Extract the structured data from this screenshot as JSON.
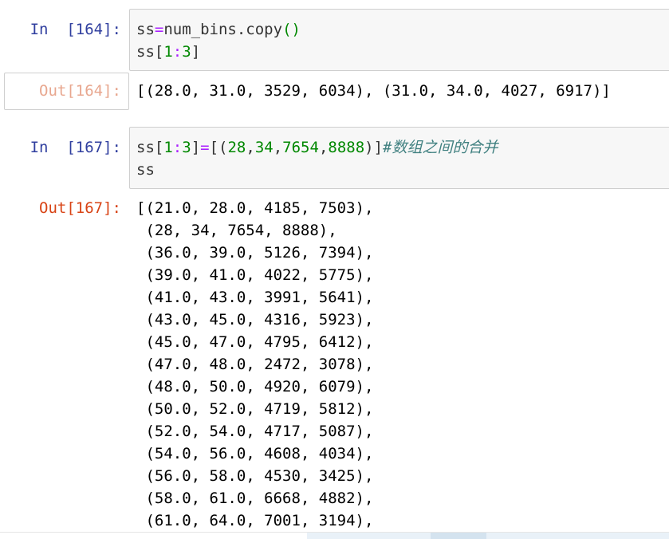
{
  "cells": [
    {
      "in_prompt": "In  [164]:",
      "code": {
        "line1": {
          "a": "ss",
          "op": "=",
          "b": "num_bins.copy",
          "paren": "()"
        },
        "line2": {
          "a": "ss[",
          "n1": "1",
          "c": ":",
          "n2": "3",
          "d": "]"
        }
      },
      "out_prompt": "Out[164]:",
      "output": "[(28.0, 31.0, 3529, 6034), (31.0, 34.0, 4027, 6917)]"
    },
    {
      "in_prompt": "In  [167]:",
      "code": {
        "line1": {
          "a": "ss[",
          "n1": "1",
          "c": ":",
          "n2": "3",
          "d": "]",
          "op": "=",
          "e": "[(",
          "v1": "28",
          "v2": "34",
          "v3": "7654",
          "v4": "8888",
          "f": ")]",
          "comment": "#数组之间的合并"
        },
        "line2": {
          "a": "ss"
        }
      },
      "out_prompt": "Out[167]:",
      "output_lines": [
        "[(21.0, 28.0, 4185, 7503),",
        " (28, 34, 7654, 8888),",
        " (36.0, 39.0, 5126, 7394),",
        " (39.0, 41.0, 4022, 5775),",
        " (41.0, 43.0, 3991, 5641),",
        " (43.0, 45.0, 4316, 5923),",
        " (45.0, 47.0, 4795, 6412),",
        " (47.0, 48.0, 2472, 3078),",
        " (48.0, 50.0, 4920, 6079),",
        " (50.0, 52.0, 4719, 5812),",
        " (52.0, 54.0, 4717, 5087),",
        " (54.0, 56.0, 4608, 4034),",
        " (56.0, 58.0, 4530, 3425),",
        " (58.0, 61.0, 6668, 4882),",
        " (61.0, 64.0, 7001, 3194),"
      ]
    }
  ],
  "colors": {
    "in_prompt": "#303f9f",
    "out_prompt": "#d84315",
    "operator": "#aa22ff",
    "number": "#008800",
    "comment": "#408080",
    "input_bg": "#f7f7f7"
  }
}
